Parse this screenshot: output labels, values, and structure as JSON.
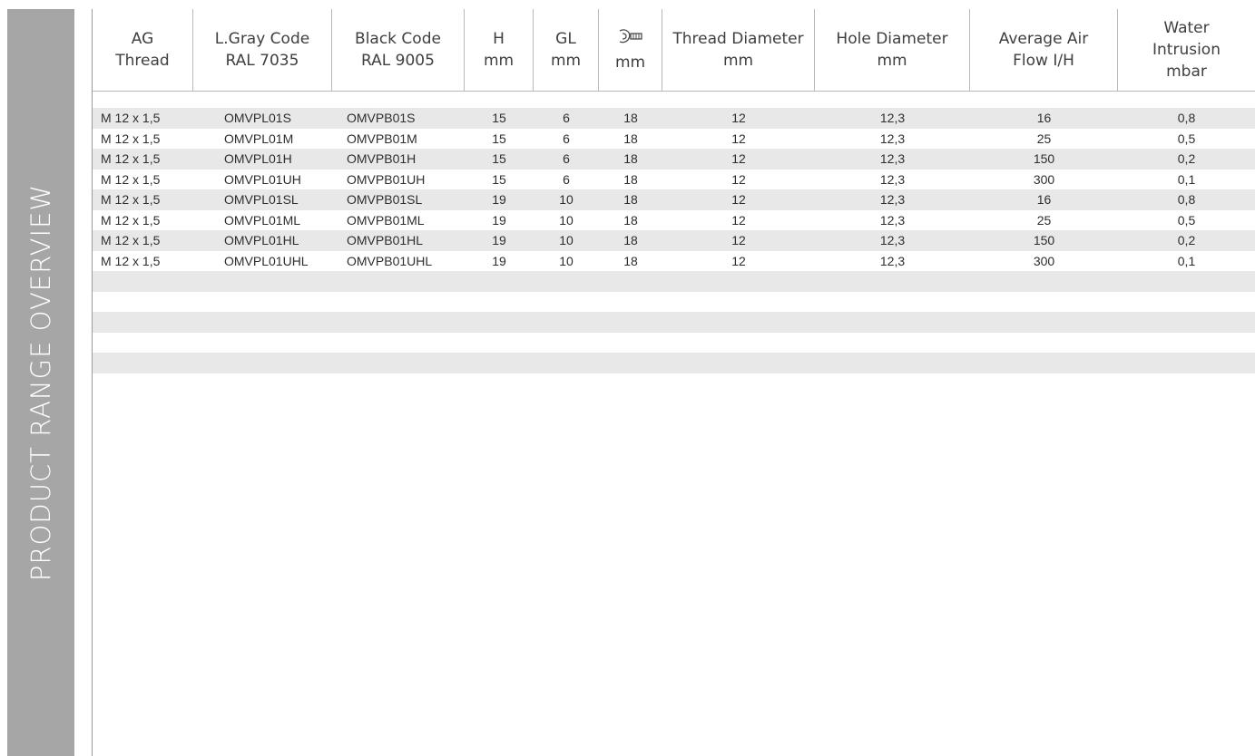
{
  "side_title": "PRODUCT RANGE OVERVIEW",
  "header": [
    [
      "AG",
      "Thread"
    ],
    [
      "L.Gray Code",
      "RAL 7035"
    ],
    [
      "Black Code",
      "RAL 9005"
    ],
    [
      "H",
      "mm"
    ],
    [
      "GL",
      "mm"
    ],
    [
      "",
      "mm"
    ],
    [
      "Thread Diameter",
      "mm"
    ],
    [
      "Hole Diameter",
      "mm"
    ],
    [
      "Average Air",
      "Flow I/H"
    ],
    [
      "Water",
      "Intrusion",
      "mbar"
    ]
  ],
  "wrench_icon": "wrench-icon",
  "rows": [
    [
      "M 12 x 1,5",
      "OMVPL01S",
      "OMVPB01S",
      "15",
      "6",
      "18",
      "12",
      "12,3",
      "16",
      "0,8"
    ],
    [
      "M 12 x 1,5",
      "OMVPL01M",
      "OMVPB01M",
      "15",
      "6",
      "18",
      "12",
      "12,3",
      "25",
      "0,5"
    ],
    [
      "M 12 x 1,5",
      "OMVPL01H",
      "OMVPB01H",
      "15",
      "6",
      "18",
      "12",
      "12,3",
      "150",
      "0,2"
    ],
    [
      "M 12 x 1,5",
      "OMVPL01UH",
      "OMVPB01UH",
      "15",
      "6",
      "18",
      "12",
      "12,3",
      "300",
      "0,1"
    ],
    [
      "M 12 x 1,5",
      "OMVPL01SL",
      "OMVPB01SL",
      "19",
      "10",
      "18",
      "12",
      "12,3",
      "16",
      "0,8"
    ],
    [
      "M 12 x 1,5",
      "OMVPL01ML",
      "OMVPB01ML",
      "19",
      "10",
      "18",
      "12",
      "12,3",
      "25",
      "0,5"
    ],
    [
      "M 12 x 1,5",
      "OMVPL01HL",
      "OMVPB01HL",
      "19",
      "10",
      "18",
      "12",
      "12,3",
      "150",
      "0,2"
    ],
    [
      "M 12 x 1,5",
      "OMVPL01UHL",
      "OMVPB01UHL",
      "19",
      "10",
      "18",
      "12",
      "12,3",
      "300",
      "0,1"
    ]
  ],
  "empty_row_count": 5
}
